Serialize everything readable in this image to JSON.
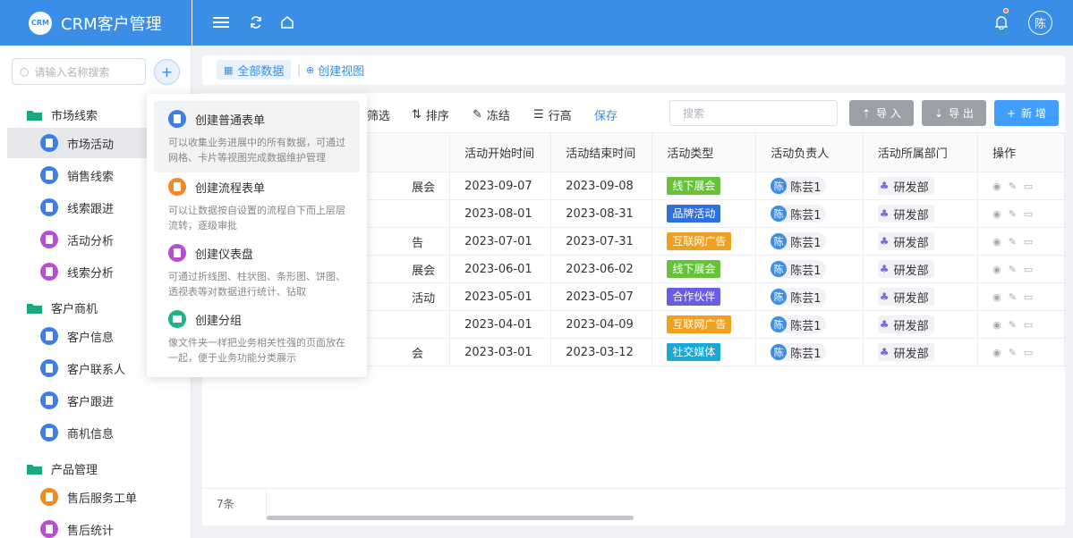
{
  "app": {
    "logo": "CRM",
    "title": "CRM客户管理",
    "avatar": "陈"
  },
  "sidebar": {
    "search_placeholder": "请输入名称搜索",
    "groups": [
      {
        "label": "市场线索",
        "items": [
          "市场活动",
          "销售线索",
          "线索跟进",
          "活动分析",
          "线索分析"
        ]
      },
      {
        "label": "客户商机",
        "items": [
          "客户信息",
          "客户联系人",
          "客户跟进",
          "商机信息"
        ]
      },
      {
        "label": "产品管理",
        "items": [
          "售后服务工单",
          "售后统计"
        ]
      }
    ]
  },
  "viewbar": {
    "all": "全部数据",
    "create": "创建视图"
  },
  "toolbar": {
    "filter": "筛选",
    "sort": "排序",
    "freeze": "冻结",
    "rowheight": "行高",
    "save": "保存",
    "search_placeholder": "搜索",
    "import": "导 入",
    "export": "导 出",
    "new": "新 增"
  },
  "table": {
    "headers": [
      "活动开始时间",
      "活动结束时间",
      "活动类型",
      "活动负责人",
      "活动所属部门",
      "操作"
    ],
    "rows": [
      {
        "name_tail": "展会",
        "start": "2023-09-07",
        "end": "2023-09-08",
        "type": "线下展会",
        "color": "#67c23a",
        "owner": "陈芸1",
        "dept": "研发部"
      },
      {
        "name_tail": "",
        "start": "2023-08-01",
        "end": "2023-08-31",
        "type": "品牌活动",
        "color": "#2f6fe0",
        "owner": "陈芸1",
        "dept": "研发部"
      },
      {
        "name_tail": "告",
        "start": "2023-07-01",
        "end": "2023-07-31",
        "type": "互联网广告",
        "color": "#f0a020",
        "owner": "陈芸1",
        "dept": "研发部"
      },
      {
        "name_tail": "展会",
        "start": "2023-06-01",
        "end": "2023-06-02",
        "type": "线下展会",
        "color": "#67c23a",
        "owner": "陈芸1",
        "dept": "研发部"
      },
      {
        "name_tail": "活动",
        "start": "2023-05-01",
        "end": "2023-05-07",
        "type": "合作伙伴",
        "color": "#6b5ce7",
        "owner": "陈芸1",
        "dept": "研发部"
      },
      {
        "name_tail": "",
        "start": "2023-04-01",
        "end": "2023-04-09",
        "type": "互联网广告",
        "color": "#f0a020",
        "owner": "陈芸1",
        "dept": "研发部"
      },
      {
        "name_tail": "会",
        "start": "2023-03-01",
        "end": "2023-03-12",
        "type": "社交媒体",
        "color": "#19a9d5",
        "owner": "陈芸1",
        "dept": "研发部"
      }
    ],
    "count": "7条"
  },
  "popup": [
    {
      "title": "创建普通表单",
      "desc": "可以收集业务进展中的所有数据，可通过网格、卡片等视图完成数据维护管理",
      "color": "#3e7ee6"
    },
    {
      "title": "创建流程表单",
      "desc": "可以让数据按自设置的流程自下而上层层流转，逐级审批",
      "color": "#f08a24"
    },
    {
      "title": "创建仪表盘",
      "desc": "可通过折线图、柱状图、条形图、饼图、透视表等对数据进行统计、钻取",
      "color": "#b84ed6"
    },
    {
      "title": "创建分组",
      "desc": "像文件夹一样把业务相关性强的页面放在一起，便于业务功能分类展示",
      "color": "#1fb38a"
    }
  ]
}
